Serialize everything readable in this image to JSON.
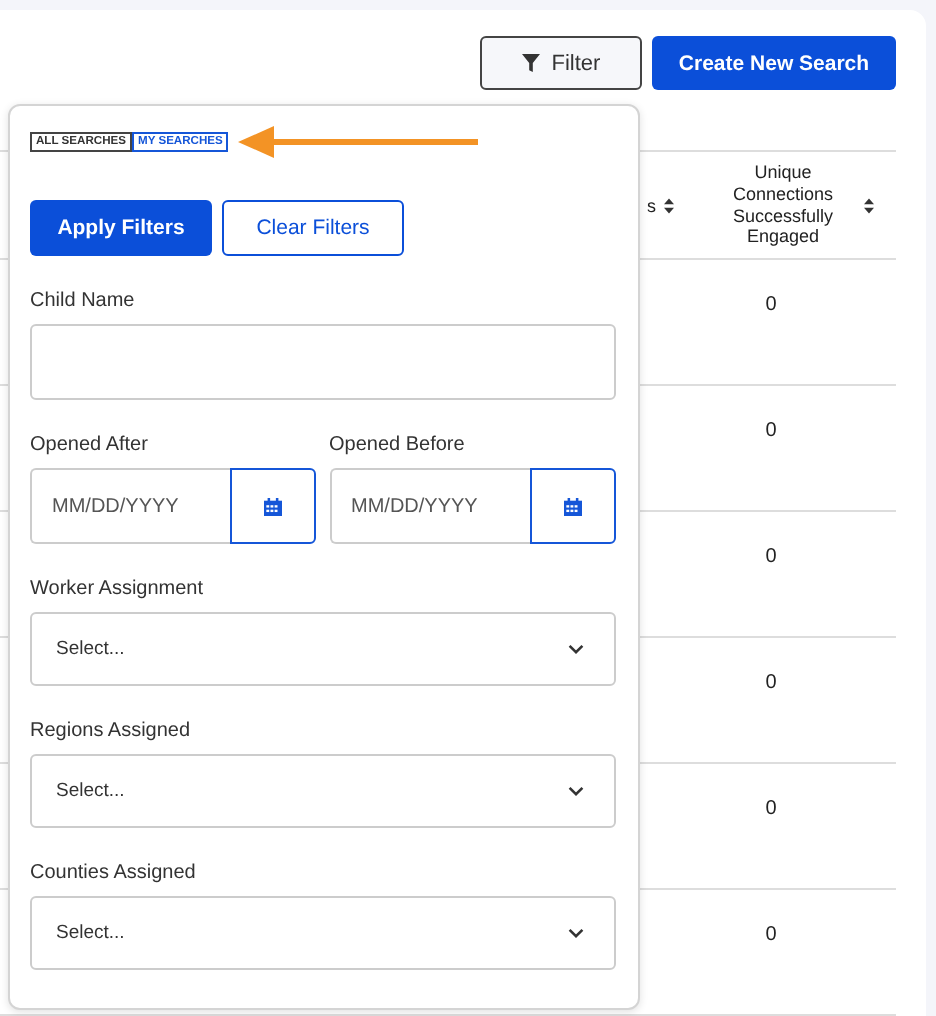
{
  "toolbar": {
    "filter_button": "Filter",
    "create_button": "Create New Search"
  },
  "table": {
    "columns": [
      {
        "label": "s",
        "sortable": true
      },
      {
        "label": "Unique Connections Successfully Engaged",
        "sortable": true
      }
    ],
    "rows": [
      {
        "column_2": "0"
      },
      {
        "column_2": "0"
      },
      {
        "column_2": "0"
      },
      {
        "column_2": "0"
      },
      {
        "column_2": "0"
      },
      {
        "column_2": "0"
      }
    ]
  },
  "filter_panel": {
    "tabs": [
      {
        "label": "ALL SEARCHES",
        "selected": false
      },
      {
        "label": "MY SEARCHES",
        "selected": true
      }
    ],
    "apply_button": "Apply Filters",
    "clear_button": "Clear Filters",
    "fields": [
      {
        "kind": "text",
        "label": "Child Name"
      },
      {
        "kind": "date_pair",
        "items": [
          {
            "label": "Opened After",
            "placeholder": "MM/DD/YYYY"
          },
          {
            "label": "Opened Before",
            "placeholder": "MM/DD/YYYY"
          }
        ]
      },
      {
        "kind": "select",
        "label": "Worker Assignment",
        "placeholder": "Select..."
      },
      {
        "kind": "select",
        "label": "Regions Assigned",
        "placeholder": "Select..."
      },
      {
        "kind": "select",
        "label": "Counties Assigned",
        "placeholder": "Select..."
      }
    ]
  }
}
